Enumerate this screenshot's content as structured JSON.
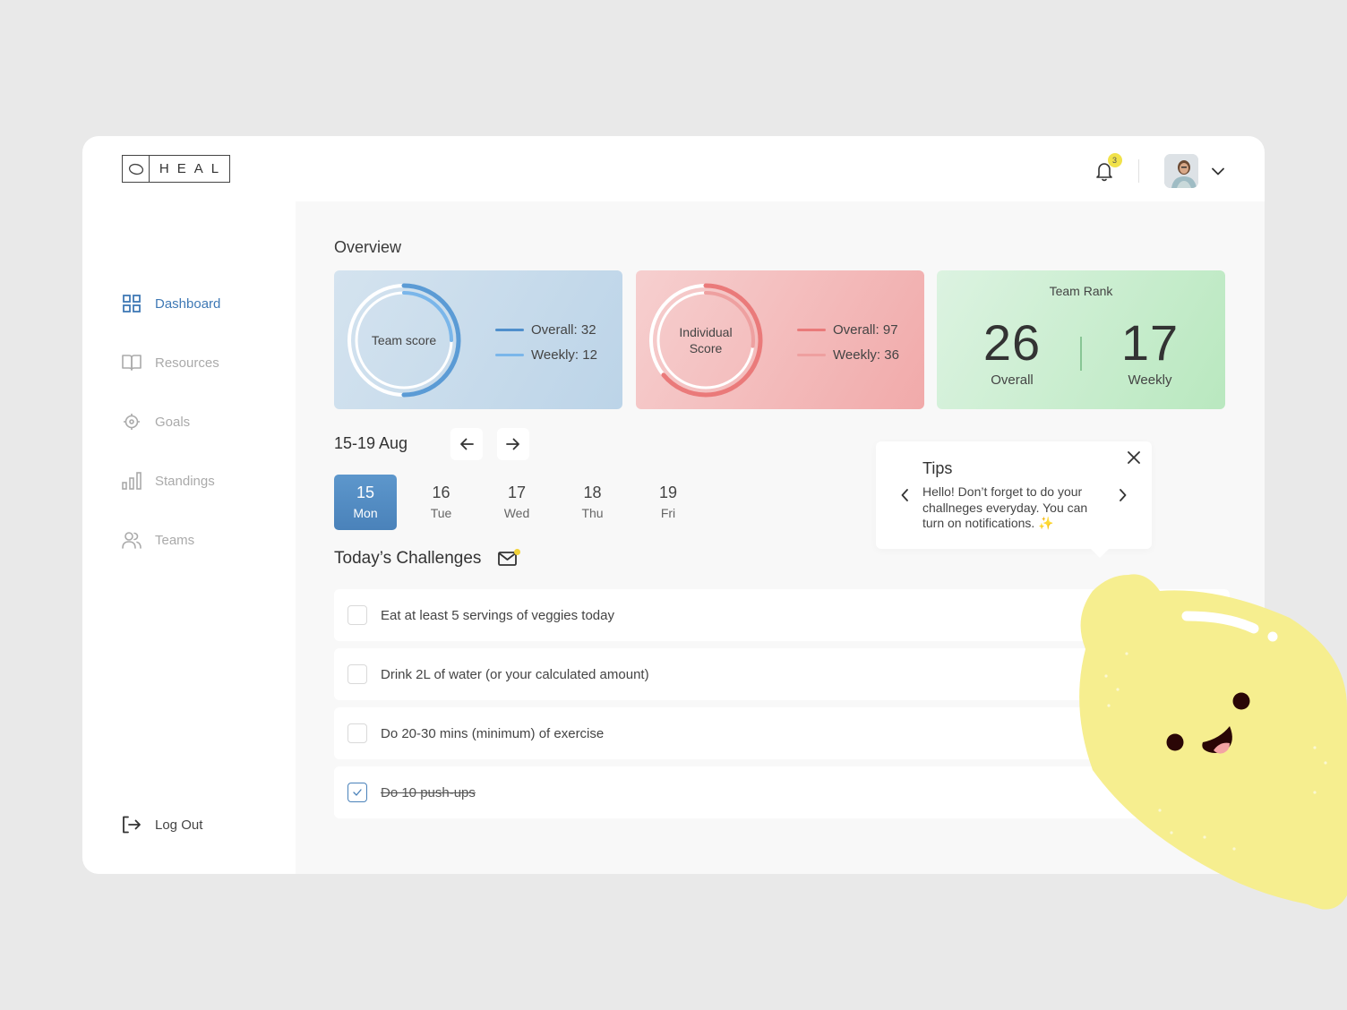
{
  "brand": {
    "name": "HEAL",
    "logo_icon": "leaf-outline-icon"
  },
  "topbar": {
    "notification_icon": "bell-icon",
    "notification_count": "3",
    "avatar_alt": "User avatar",
    "menu_icon": "chevron-down-icon"
  },
  "sidebar": {
    "items": [
      {
        "label": "Dashboard",
        "icon": "grid-icon",
        "active": true
      },
      {
        "label": "Resources",
        "icon": "book-icon",
        "active": false
      },
      {
        "label": "Goals",
        "icon": "target-icon",
        "active": false
      },
      {
        "label": "Standings",
        "icon": "bar-chart-icon",
        "active": false
      },
      {
        "label": "Teams",
        "icon": "users-icon",
        "active": false
      }
    ],
    "logout_label": "Log Out"
  },
  "overview": {
    "title": "Overview",
    "team_score": {
      "label": "Team score",
      "overall_label": "Overall: 32",
      "weekly_label": "Weekly: 12",
      "overall_fraction": 0.5,
      "weekly_fraction": 0.25,
      "colors": {
        "overall": "#5b9bd5",
        "weekly": "#7ab6ea"
      }
    },
    "individual_score": {
      "label_line1": "Individual",
      "label_line2": "Score",
      "overall_label": "Overall: 97",
      "weekly_label": "Weekly: 36",
      "overall_fraction": 0.64,
      "weekly_fraction": 0.27,
      "colors": {
        "overall": "#ea7a7a",
        "weekly": "#eea0a0"
      }
    },
    "team_rank": {
      "title": "Team Rank",
      "overall_value": "26",
      "overall_label": "Overall",
      "weekly_value": "17",
      "weekly_label": "Weekly"
    }
  },
  "week": {
    "range": "15-19 Aug",
    "prev_icon": "arrow-left-icon",
    "next_icon": "arrow-right-icon",
    "days": [
      {
        "date": "15",
        "weekday": "Mon",
        "selected": true
      },
      {
        "date": "16",
        "weekday": "Tue",
        "selected": false
      },
      {
        "date": "17",
        "weekday": "Wed",
        "selected": false
      },
      {
        "date": "18",
        "weekday": "Thu",
        "selected": false
      },
      {
        "date": "19",
        "weekday": "Fri",
        "selected": false
      }
    ]
  },
  "challenges": {
    "title": "Today’s Challenges",
    "mail_icon": "mail-icon",
    "items": [
      {
        "text": "Eat at least 5 servings of veggies today",
        "done": false
      },
      {
        "text": "Drink 2L of water (or your calculated amount)",
        "done": false
      },
      {
        "text": "Do 20-30 mins (minimum) of exercise",
        "done": false
      },
      {
        "text": "Do 10 push-ups",
        "done": true
      }
    ]
  },
  "tips": {
    "title": "Tips",
    "body": "Hello! Don’t forget to do your challneges everyday. You can turn on notifications.",
    "sparkle": "✨"
  },
  "mascot": {
    "name": "lemon-mascot"
  }
}
